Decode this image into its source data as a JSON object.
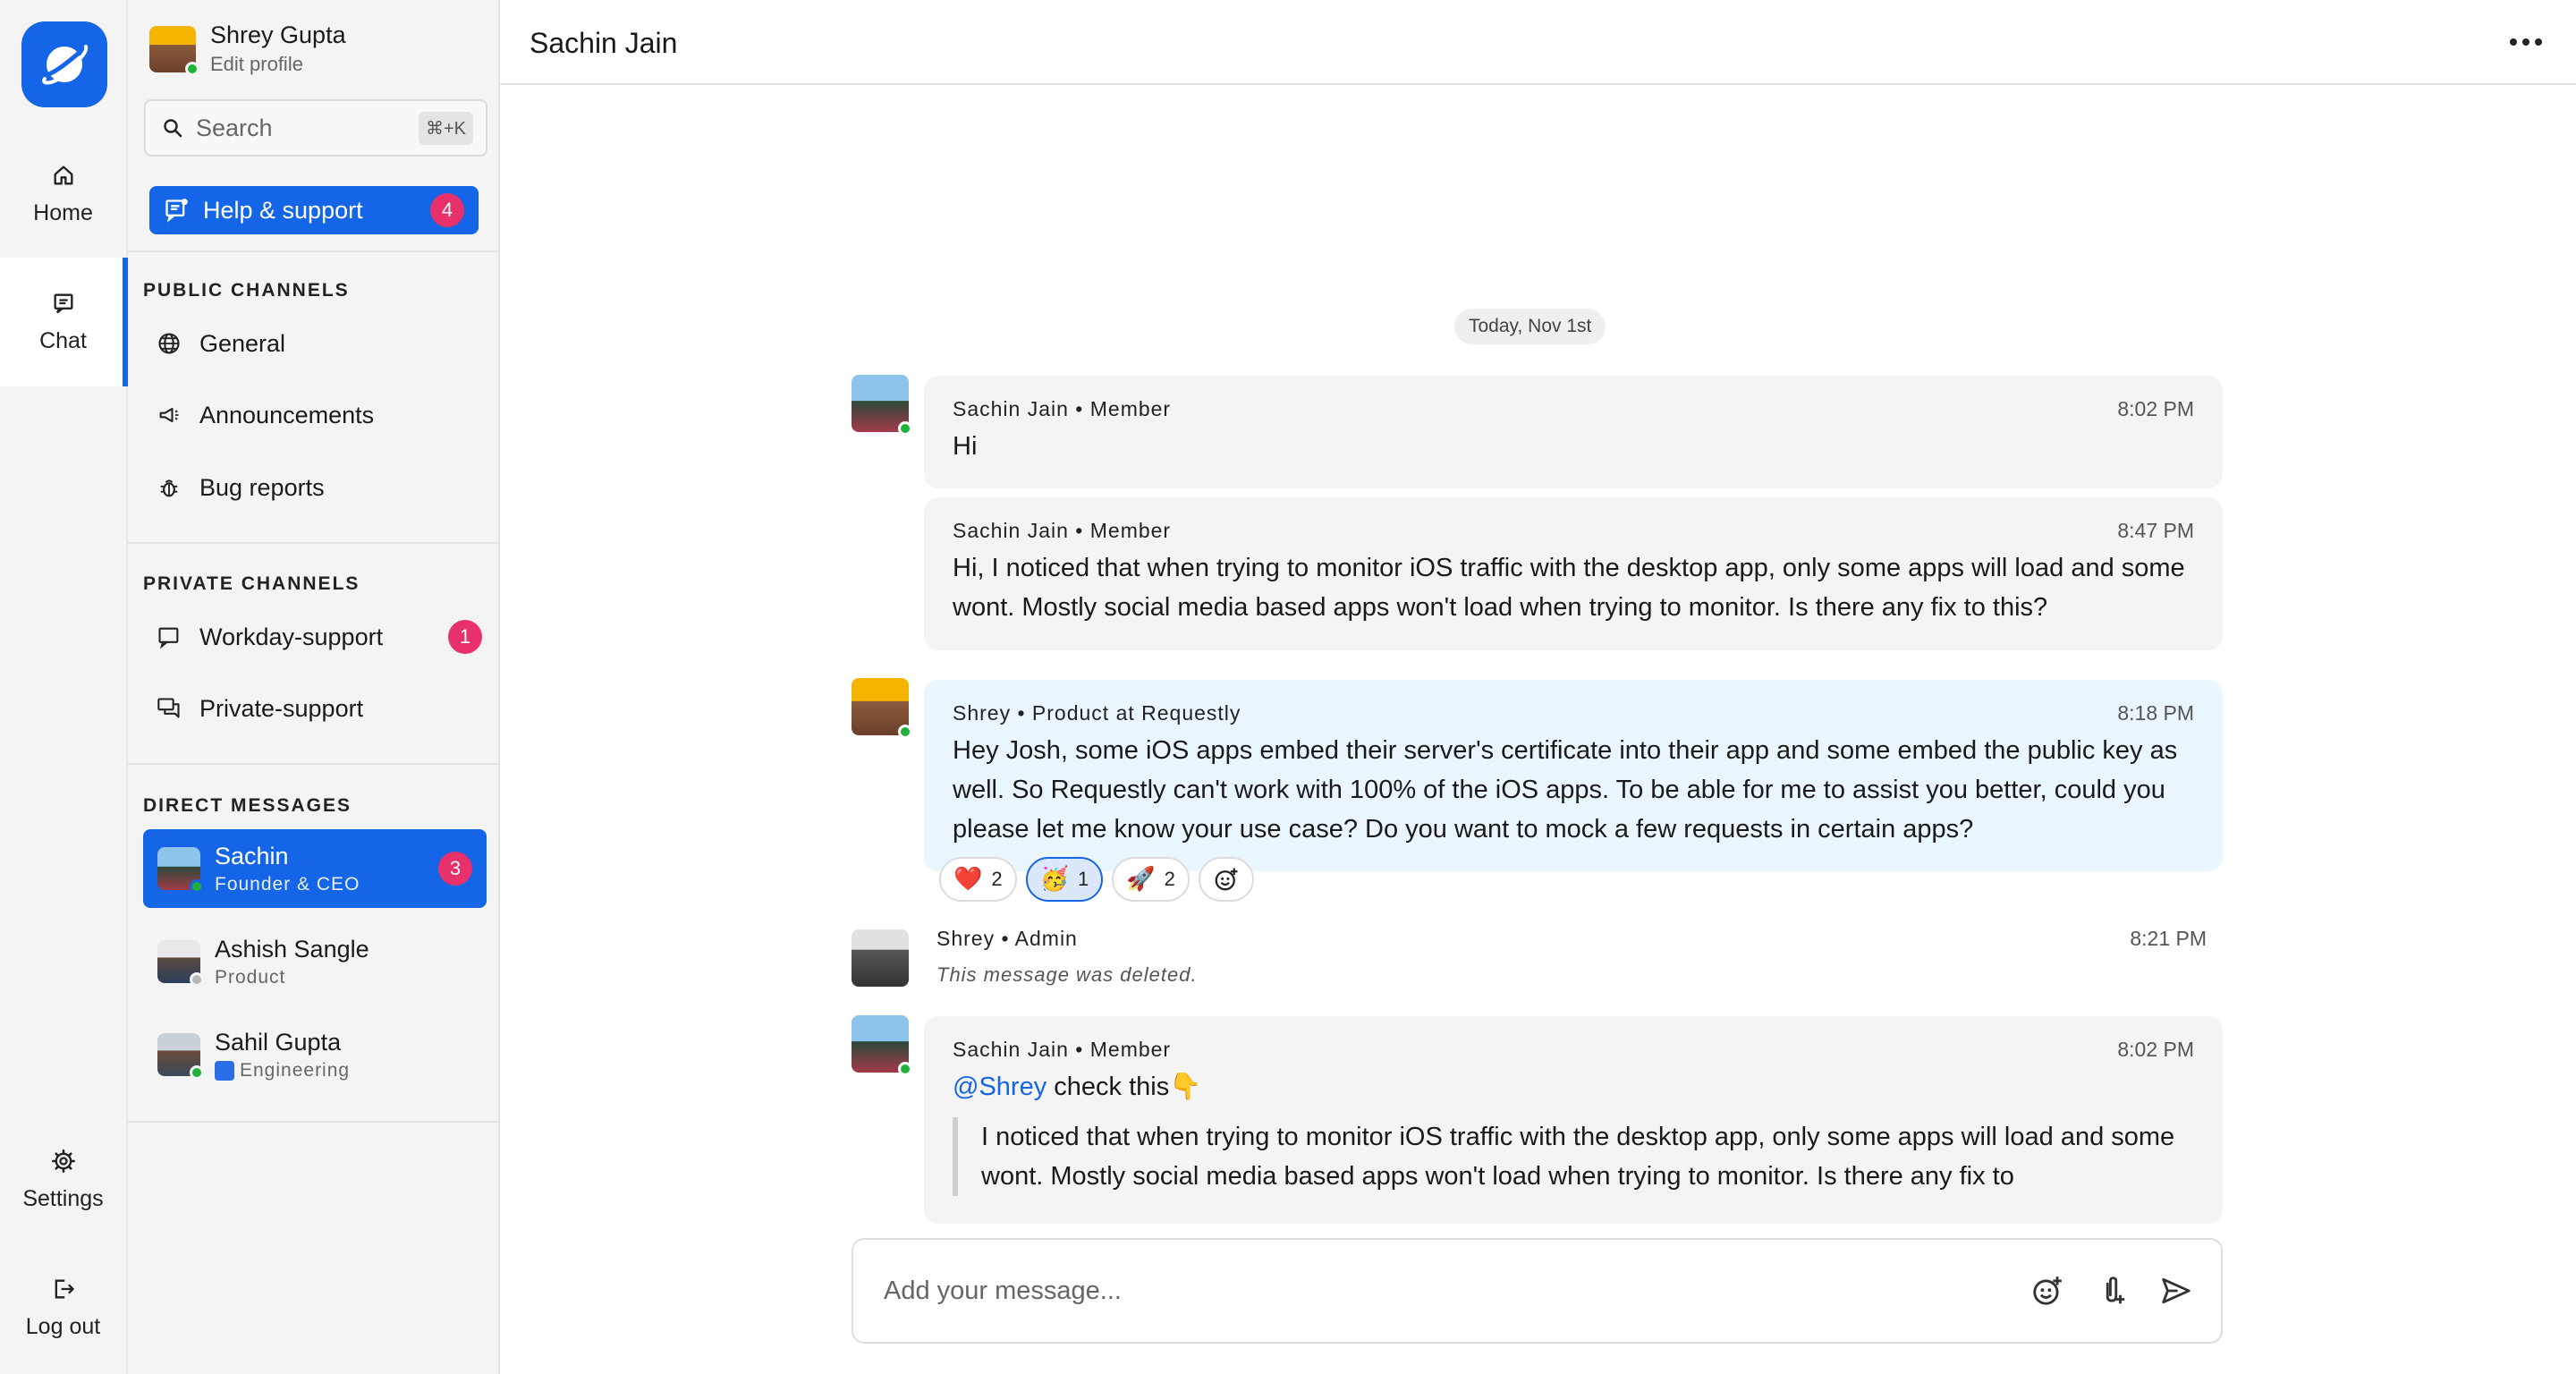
{
  "nav": {
    "home_label": "Home",
    "chat_label": "Chat",
    "settings_label": "Settings",
    "logout_label": "Log out"
  },
  "profile": {
    "name": "Shrey Gupta",
    "subtitle": "Edit profile"
  },
  "search": {
    "placeholder": "Search",
    "shortcut": "⌘+K"
  },
  "help": {
    "label": "Help & support",
    "count": "4"
  },
  "public_channels": {
    "title": "PUBLIC CHANNELS",
    "items": [
      {
        "label": "General",
        "icon": "globe-icon"
      },
      {
        "label": "Announcements",
        "icon": "megaphone-icon"
      },
      {
        "label": "Bug reports",
        "icon": "bug-icon"
      }
    ]
  },
  "private_channels": {
    "title": "PRIVATE CHANNELS",
    "items": [
      {
        "label": "Workday-support",
        "icon": "chat-bubble-icon",
        "count": "1"
      },
      {
        "label": "Private-support",
        "icon": "chat-bubbles-icon"
      }
    ]
  },
  "direct_messages": {
    "title": "DIRECT MESSAGES",
    "items": [
      {
        "name": "Sachin",
        "role": "Founder & CEO",
        "count": "3",
        "active": true
      },
      {
        "name": "Ashish  Sangle",
        "role": "Product"
      },
      {
        "name": "Sahil Gupta",
        "role": "Engineering"
      }
    ]
  },
  "conversation": {
    "title": "Sachin Jain",
    "date_divider": "Today, Nov 1st",
    "messages": [
      {
        "author": "Sachin Jain • Member",
        "time": "8:02 PM",
        "text": "Hi"
      },
      {
        "author": "Sachin Jain • Member",
        "time": "8:47 PM",
        "text": "Hi, I noticed that when trying to monitor iOS traffic with the desktop app, only some apps will load and some wont. Mostly social media based apps won't load when trying to monitor. Is there any fix to this?"
      },
      {
        "author": "Shrey • Product at Requestly",
        "time": "8:18 PM",
        "text": "Hey Josh, some iOS apps embed their server's certificate into their app and some embed the public key as well. So Requestly can't work with 100% of the iOS apps. To be able for me to assist you better, could you please let me know your use case? Do you want to mock a few requests in certain apps?"
      },
      {
        "author": "Shrey • Admin",
        "time": "8:21 PM",
        "text": "This message was deleted."
      },
      {
        "author": "Sachin Jain • Member",
        "time": "8:02 PM",
        "mention": "@Shrey",
        "text": " check this👇",
        "quote": "I noticed that when trying to monitor iOS traffic with the desktop app, only some apps will load and some wont. Mostly social media based apps won't load when trying to monitor. Is there any fix to"
      }
    ],
    "reactions": [
      {
        "emoji": "❤️",
        "count": "2"
      },
      {
        "emoji": "🥳",
        "count": "1"
      },
      {
        "emoji": "🚀",
        "count": "2"
      }
    ]
  },
  "composer": {
    "placeholder": "Add your message..."
  },
  "colors": {
    "accent": "#1565e8",
    "badge": "#e8306b",
    "online": "#1fb33a",
    "bubble": "#f4f4f4",
    "bubble_own": "#eaf6fd"
  }
}
